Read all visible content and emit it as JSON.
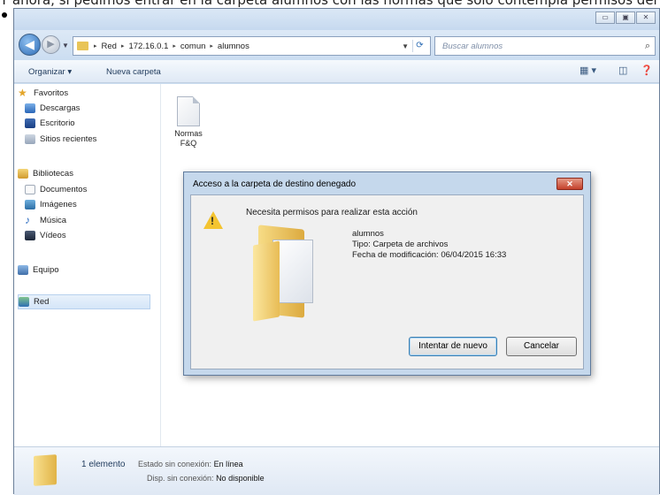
{
  "top_text": "Y ahora, si pedimos entrar en la carpeta alumnos con las normas que solo contempla permisos del",
  "window": {
    "buttons": [
      "▭",
      "▣",
      "✕"
    ]
  },
  "address": {
    "back_label": "◀",
    "forward_label": "▶",
    "crumbs": [
      "Red",
      "172.16.0.1",
      "comun",
      "alumnos"
    ],
    "separator": "▸",
    "search_placeholder": "Buscar alumnos"
  },
  "toolbar": {
    "organize": "Organizar ▾",
    "new_folder": "Nueva carpeta"
  },
  "nav": {
    "favorites": "Favoritos",
    "downloads": "Descargas",
    "desktop": "Escritorio",
    "recent": "Sitios recientes",
    "libraries": "Bibliotecas",
    "documents": "Documentos",
    "images": "Imágenes",
    "music": "Música",
    "videos": "Vídeos",
    "computer": "Equipo",
    "network": "Red"
  },
  "file": {
    "name_line1": "Normas",
    "name_line2": "F&Q"
  },
  "dialog": {
    "title": "Acceso a la carpeta de destino denegado",
    "close_label": "✕",
    "message": "Necesita permisos para realizar esta acción",
    "folder_name": "alumnos",
    "type_line": "Tipo: Carpeta de archivos",
    "date_line": "Fecha de modificación: 06/04/2015 16:33",
    "retry_button": "Intentar de nuevo",
    "cancel_button": "Cancelar"
  },
  "status": {
    "count": "1 elemento",
    "offline_label": "Estado sin conexión:",
    "offline_value": "En línea",
    "avail_label": "Disp. sin conexión:",
    "avail_value": "No disponible"
  }
}
